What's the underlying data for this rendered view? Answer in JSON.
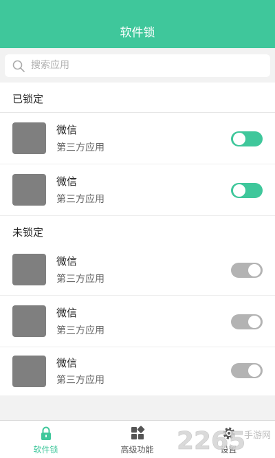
{
  "header": {
    "title": "软件锁"
  },
  "search": {
    "placeholder": "搜索应用",
    "value": ""
  },
  "sections": {
    "locked": {
      "title": "已锁定",
      "items": [
        {
          "name": "微信",
          "subtitle": "第三方应用",
          "locked": true
        },
        {
          "name": "微信",
          "subtitle": "第三方应用",
          "locked": true
        }
      ]
    },
    "unlocked": {
      "title": "未锁定",
      "items": [
        {
          "name": "微信",
          "subtitle": "第三方应用",
          "locked": false
        },
        {
          "name": "微信",
          "subtitle": "第三方应用",
          "locked": false
        },
        {
          "name": "微信",
          "subtitle": "第三方应用",
          "locked": false
        }
      ]
    }
  },
  "tabs": [
    {
      "label": "软件锁",
      "icon": "lock-icon",
      "active": true
    },
    {
      "label": "高级功能",
      "icon": "grid-icon",
      "active": false
    },
    {
      "label": "设置",
      "icon": "gear-icon",
      "active": false
    }
  ],
  "watermark": {
    "number": "2265",
    "site": "手游网"
  },
  "colors": {
    "accent": "#3fc79b",
    "toggle_off": "#b3b3b3",
    "app_icon": "#7f7f7f"
  }
}
